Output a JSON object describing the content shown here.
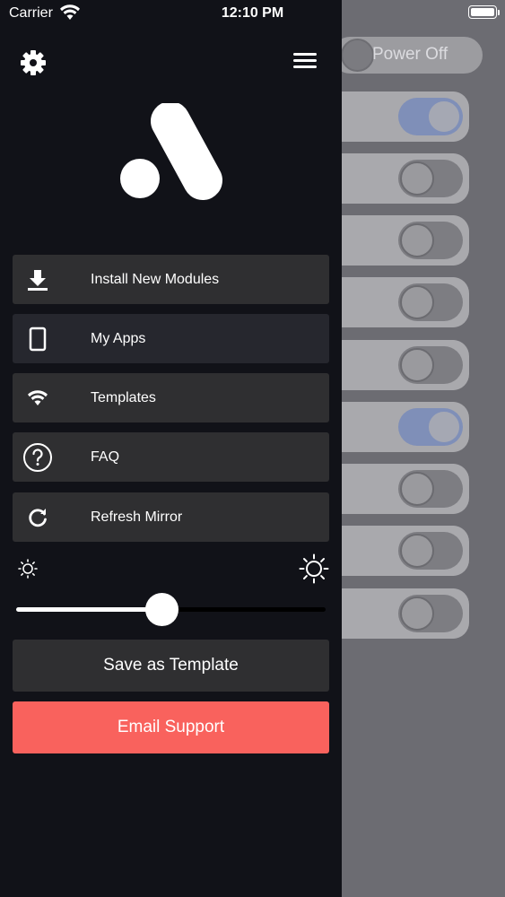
{
  "status_bar": {
    "carrier": "Carrier",
    "time": "12:10 PM"
  },
  "background": {
    "power_label": "Power Off",
    "toggles": [
      {
        "on": true
      },
      {
        "on": false
      },
      {
        "on": false
      },
      {
        "on": false
      },
      {
        "on": false
      },
      {
        "on": true
      },
      {
        "on": false
      },
      {
        "on": false
      },
      {
        "on": false
      }
    ]
  },
  "drawer": {
    "menu": [
      {
        "label": "Install New Modules",
        "icon": "download-icon"
      },
      {
        "label": "My Apps",
        "icon": "tablet-icon"
      },
      {
        "label": "Templates",
        "icon": "wifi-icon"
      },
      {
        "label": "FAQ",
        "icon": "help-circle-icon"
      },
      {
        "label": "Refresh Mirror",
        "icon": "refresh-icon"
      }
    ],
    "brightness_fraction": 0.47,
    "save_template_label": "Save as Template",
    "email_support_label": "Email Support"
  },
  "colors": {
    "drawer_bg": "#111218",
    "button_bg": "#2f2f31",
    "accent": "#f9625d",
    "toggle_on": "#7f8fb8"
  }
}
